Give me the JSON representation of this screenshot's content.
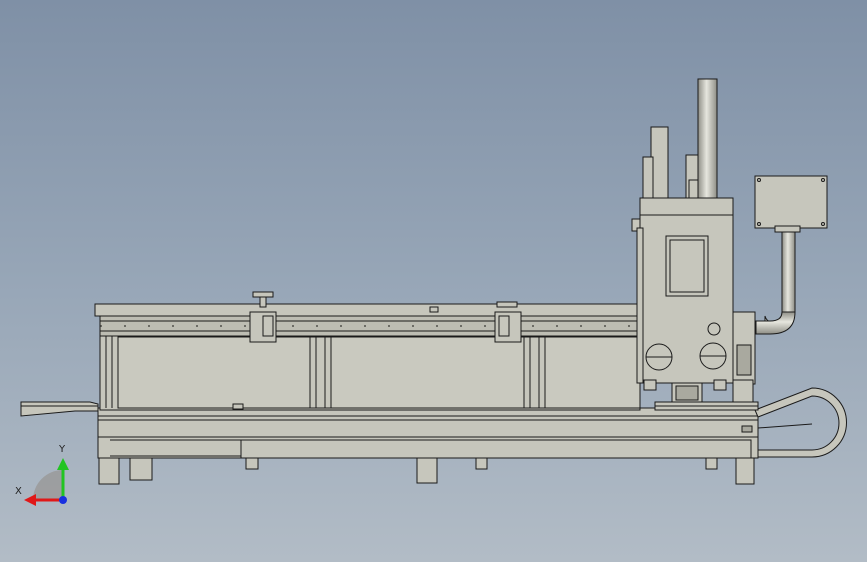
{
  "colors": {
    "background_top": "#7f90a6",
    "background_bottom": "#b2bcc6",
    "part_fill": "#c6c6bc",
    "part_fill_dark": "#a9a99f",
    "edge": "#1a1a1a",
    "axis_x": "#e01818",
    "axis_y": "#22c422",
    "axis_z": "#1830e0"
  },
  "triad": {
    "x_label": "X",
    "y_label": "Y",
    "x_icon": "axis-x-arrow-icon",
    "y_icon": "axis-y-arrow-icon",
    "z_icon": "axis-z-dot-icon"
  }
}
